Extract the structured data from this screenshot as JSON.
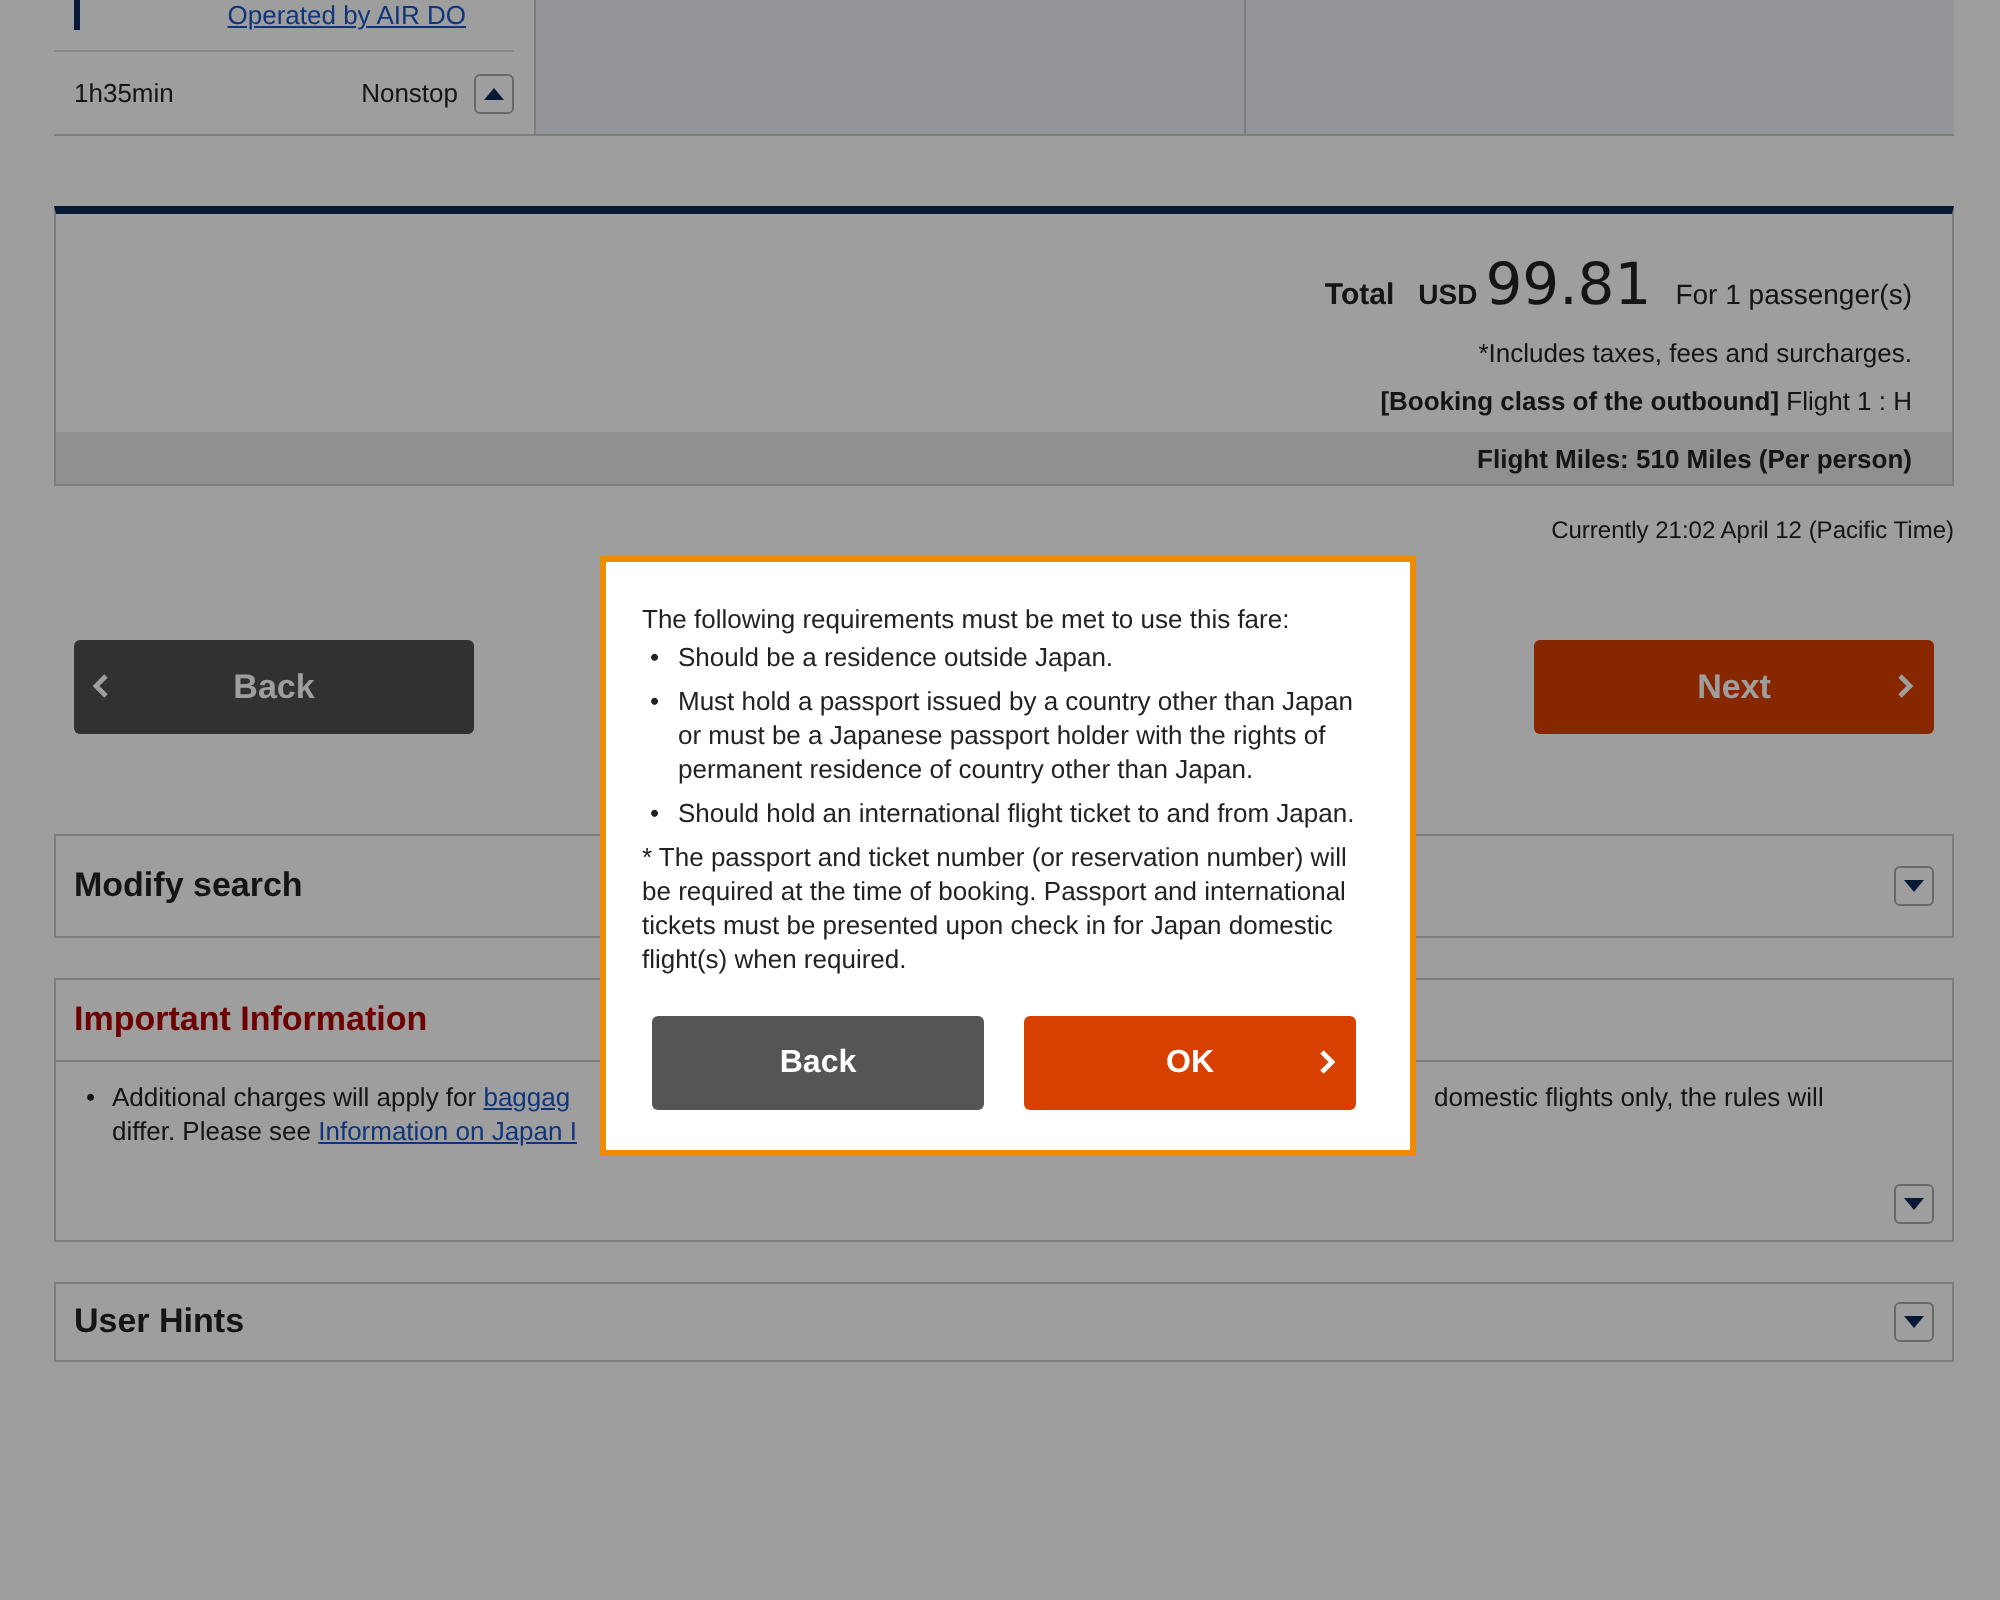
{
  "flight": {
    "operator_link": "Operated by AIR DO",
    "duration": "1h35min",
    "stops": "Nonstop",
    "expanded": true
  },
  "fare": {
    "total_label": "Total",
    "currency": "USD",
    "amount": "99.81",
    "passengers": "For 1 passenger(s)",
    "note": "*Includes taxes, fees and surcharges.",
    "booking_class": "**[Booking class of the outbound]** Flight 1 : H",
    "miles": "Flight Miles: 510 Miles (Per person)"
  },
  "current_time": "Currently 21:02 April 12 (Pacific Time)",
  "nav_buttons": [
    {
      "kind": "back",
      "label": "Back"
    },
    {
      "kind": "next",
      "label": "Next"
    }
  ],
  "sections": [
    {
      "kind": "plain",
      "title": "Modify search",
      "expanded": false
    },
    {
      "kind": "info",
      "title": "Important Information",
      "expanded": false,
      "lines": [
        {
          "bullet": "•",
          "left_text": "Additional charges will apply for ",
          "left_link": "baggag",
          "right_text": "domestic flights only, the rules will"
        },
        {
          "left_text": "differ. Please see ",
          "left_link": "Information on Japan I"
        }
      ]
    },
    {
      "kind": "plain",
      "title": "User Hints",
      "expanded": false
    }
  ],
  "modal": {
    "intro": "The following requirements must be met to use this fare:",
    "requirements": [
      {
        "bullet": "•",
        "text": "Should be a residence outside Japan."
      },
      {
        "bullet": "•",
        "text": "Must hold a passport issued by a country other than Japan or must be a Japanese passport holder with the rights of permanent residence of country other than Japan."
      },
      {
        "bullet": "•",
        "text": "Should hold an international flight ticket to and from Japan."
      }
    ],
    "note": "* The passport and ticket number (or reservation number) will be required at the time of booking. Passport and international tickets must be presented upon check in for Japan domestic flight(s) when required.",
    "buttons": [
      {
        "kind": "back",
        "label": "Back"
      },
      {
        "kind": "ok",
        "label": "OK"
      }
    ]
  }
}
